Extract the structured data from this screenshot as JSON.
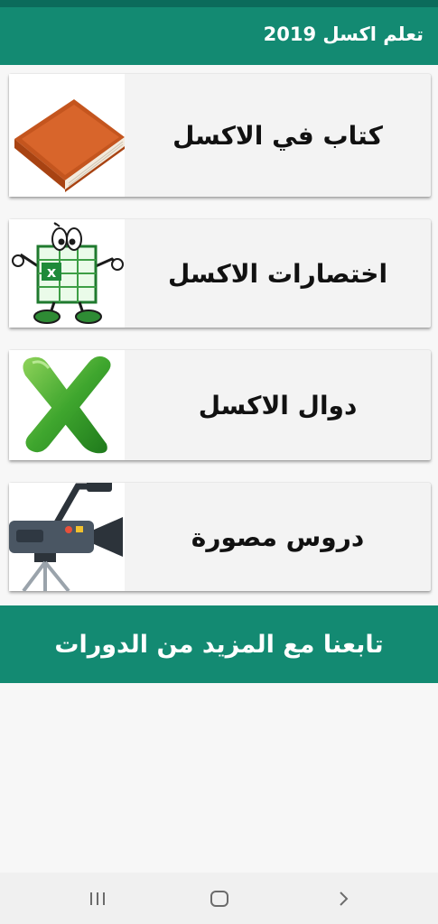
{
  "app_bar": {
    "title": "تعلم اكسل 2019"
  },
  "menu": [
    {
      "label": "كتاب في الاكسل",
      "icon": "book-icon"
    },
    {
      "label": "اختصارات الاكسل",
      "icon": "excel-mascot-icon"
    },
    {
      "label": "دوال الاكسل",
      "icon": "excel-x-logo-icon"
    },
    {
      "label": "دروس مصورة",
      "icon": "video-camera-icon"
    }
  ],
  "banner": {
    "label": "تابعنا مع المزيد من الدورات"
  },
  "nav_bar": {
    "buttons": [
      "recent-apps-icon",
      "home-icon",
      "back-icon"
    ]
  },
  "colors": {
    "primary": "#138a72",
    "status_bar": "#0b6b5b",
    "card_background": "#f3f3f3",
    "page_background": "#f7f7f7"
  }
}
